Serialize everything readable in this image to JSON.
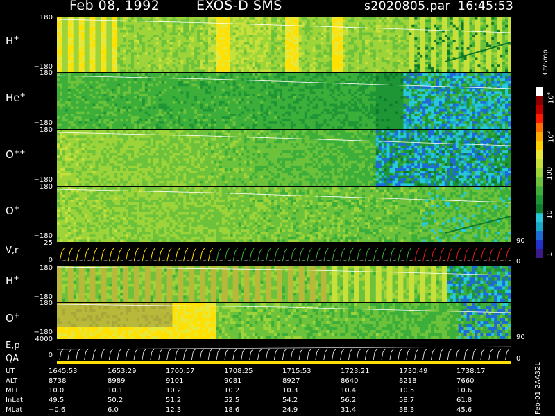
{
  "header": {
    "date": "Feb 08, 1992",
    "instrument": "EXOS-D SMS",
    "file": "s2020805.par",
    "time": "16:45:53"
  },
  "panels": [
    {
      "id": "h1",
      "label": "H",
      "sup": "+",
      "top": "180",
      "bottom": "−180"
    },
    {
      "id": "he",
      "label": "He",
      "sup": "+",
      "top": "180",
      "bottom": "−180"
    },
    {
      "id": "opp",
      "label": "O",
      "sup": "++",
      "top": "180",
      "bottom": "−180"
    },
    {
      "id": "o1",
      "label": "O",
      "sup": "+",
      "top": "180",
      "bottom": "−180"
    },
    {
      "id": "vr",
      "label": "V,r",
      "sup": "",
      "top": "25",
      "bottom": "0"
    },
    {
      "id": "h2",
      "label": "H",
      "sup": "+",
      "top": "180",
      "bottom": "−180"
    },
    {
      "id": "o2",
      "label": "O",
      "sup": "+",
      "top": "180",
      "bottom": "−180"
    },
    {
      "id": "ep",
      "label": "E,p",
      "sup": "",
      "top": "4000",
      "bottom": "0"
    }
  ],
  "qa_label": "QA",
  "right_ticks": {
    "vr_top": "90",
    "vr_bottom": "0",
    "ep_top": "90",
    "ep_bottom": "0"
  },
  "colorbar": {
    "unit": "Ct/Smp",
    "labels": {
      "e4": "10",
      "e3": "10",
      "e4_exp": "4",
      "e3_exp": "3",
      "l100": "100",
      "l10": "10",
      "l1": "1"
    },
    "colors": [
      "#3c1a8a",
      "#2233cc",
      "#1e6ad6",
      "#19a7c8",
      "#27c8d8",
      "#0f7a2a",
      "#1e9636",
      "#3cae3a",
      "#6cc23a",
      "#9cd43a",
      "#c8e03a",
      "#e8e83a",
      "#ffd000",
      "#ffaa00",
      "#ff7000",
      "#ff1a00",
      "#c00000",
      "#8a0000",
      "#ffffff"
    ]
  },
  "footer": {
    "rows": [
      {
        "name": "UT",
        "values": [
          "1645:53",
          "1653:29",
          "1700:57",
          "1708:25",
          "1715:53",
          "1723:21",
          "1730:49",
          "1738:17"
        ]
      },
      {
        "name": "ALT",
        "values": [
          "8738",
          "8989",
          "9101",
          "9081",
          "8927",
          "8640",
          "8218",
          "7660"
        ]
      },
      {
        "name": "MLT",
        "values": [
          "10.0",
          "10.1",
          "10.2",
          "10.2",
          "10.3",
          "10.4",
          "10.5",
          "10.6"
        ]
      },
      {
        "name": "InLat",
        "values": [
          "49.5",
          "50.2",
          "51.2",
          "52.5",
          "54.2",
          "56.2",
          "58.7",
          "61.8"
        ]
      },
      {
        "name": "MLat",
        "values": [
          "−0.6",
          "6.0",
          "12.3",
          "18.6",
          "24.9",
          "31.4",
          "38.3",
          "45.6"
        ]
      }
    ],
    "stamp": "Feb-01  2AA32L"
  },
  "chart_data": {
    "type": "heatmap",
    "x_ticks_ut": [
      "1645:53",
      "1653:29",
      "1700:57",
      "1708:25",
      "1715:53",
      "1723:21",
      "1730:49",
      "1738:17"
    ],
    "ion_panels_y_range": [
      -180,
      180
    ],
    "vr_y_range": [
      0,
      25
    ],
    "ep_y_range": [
      0,
      4000
    ],
    "colorbar_scale": "log",
    "colorbar_range": [
      1,
      10000
    ],
    "colorbar_unit": "Ct/Smp"
  }
}
